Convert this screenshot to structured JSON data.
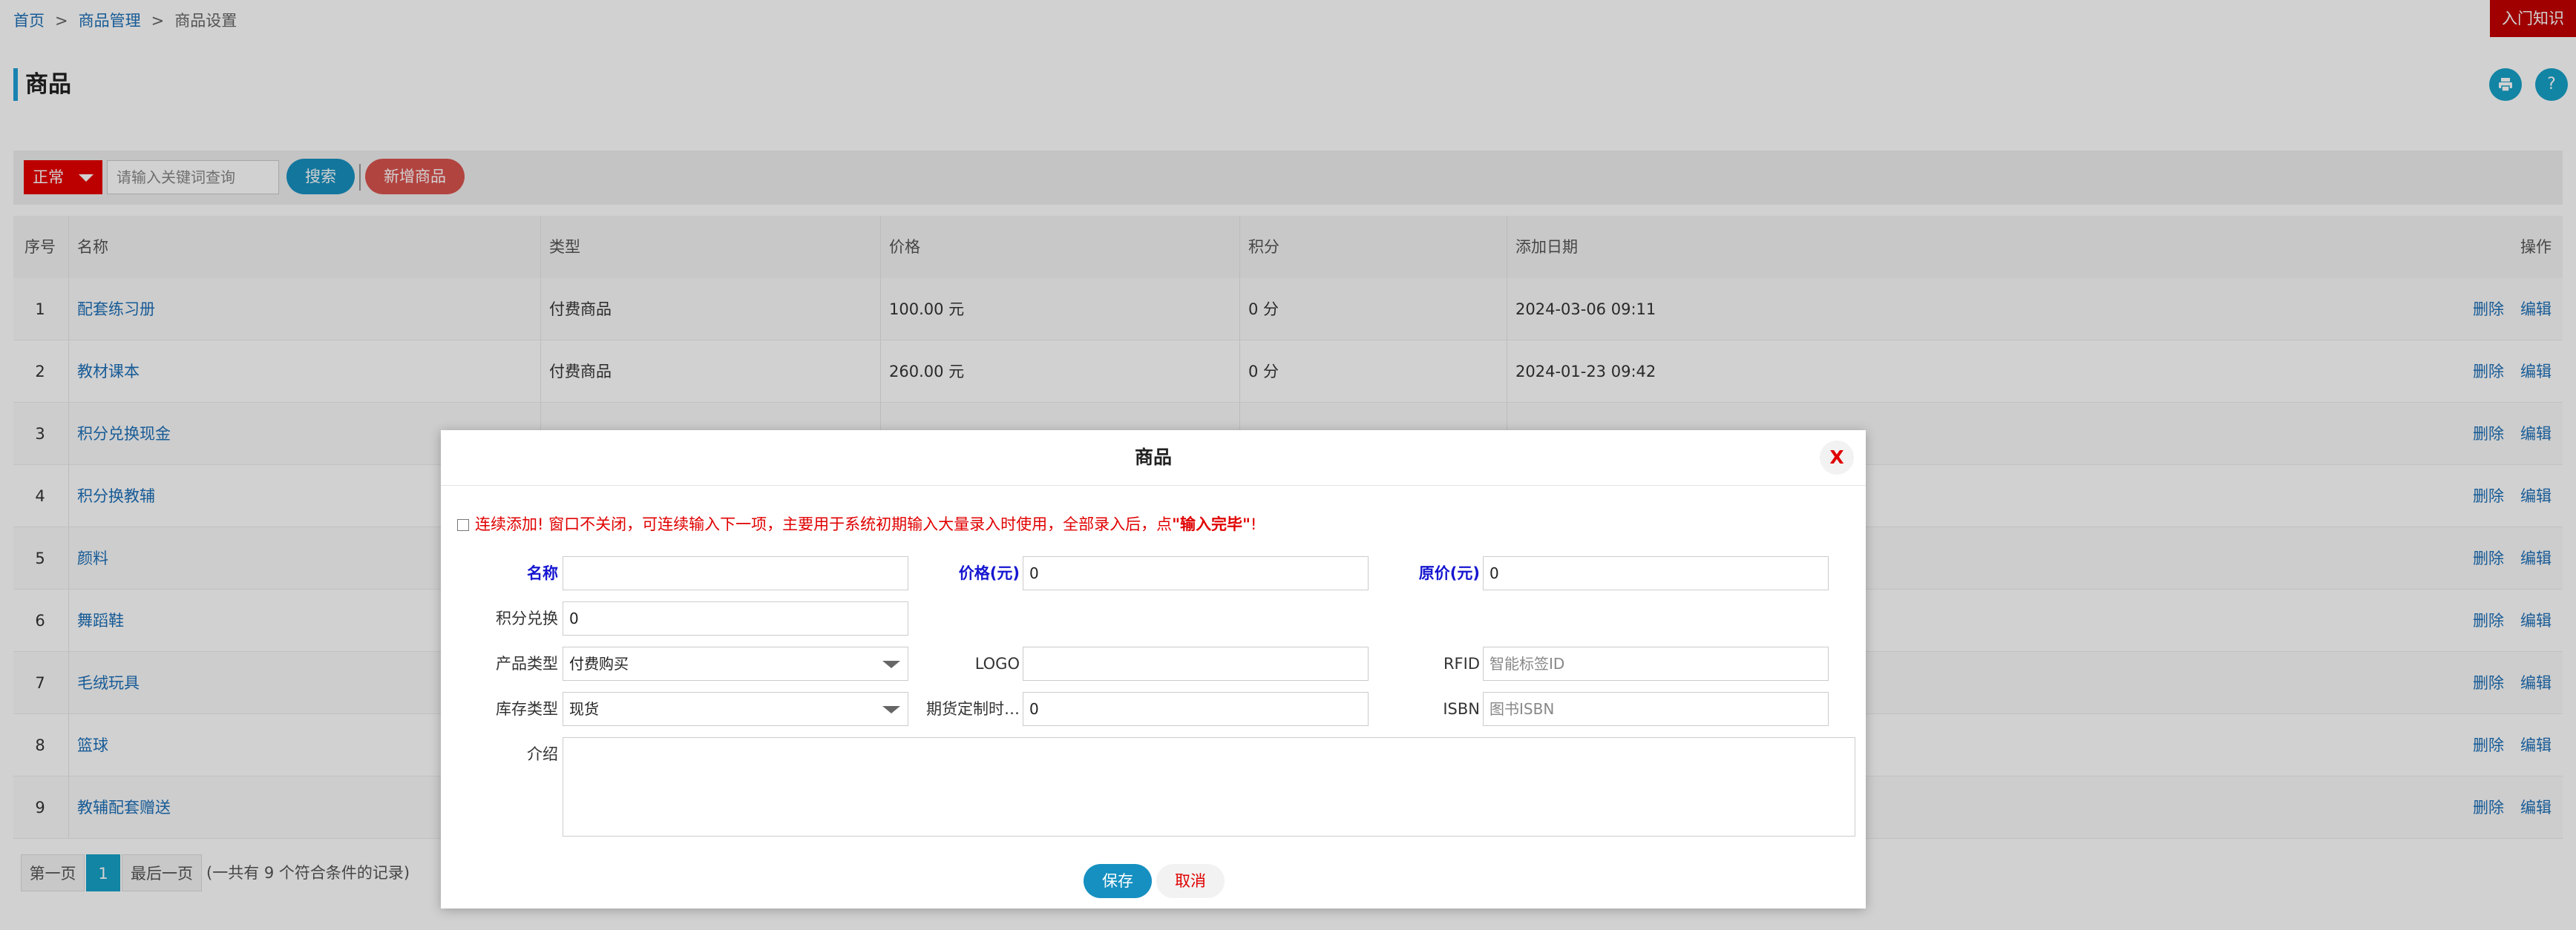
{
  "breadcrumb": {
    "home": "首页",
    "sep1": ">",
    "products": "商品管理",
    "sep2": ">",
    "current": "商品设置"
  },
  "header": {
    "intro_button": "入门知识",
    "page_title": "商品",
    "help_icon_text": "?"
  },
  "toolbar": {
    "status_value": "正常",
    "search_placeholder": "请输入关键词查询",
    "search_button": "搜索",
    "add_button": "新增商品"
  },
  "table": {
    "columns": [
      "序号",
      "名称",
      "类型",
      "价格",
      "积分",
      "添加日期",
      "操作"
    ],
    "delete_label": "删除",
    "edit_label": "编辑",
    "rows": [
      {
        "idx": "1",
        "name": "配套练习册",
        "type": "付费商品",
        "price": "100.00 元",
        "points": "0 分",
        "date": "2024-03-06 09:11"
      },
      {
        "idx": "2",
        "name": "教材课本",
        "type": "付费商品",
        "price": "260.00 元",
        "points": "0 分",
        "date": "2024-01-23 09:42"
      },
      {
        "idx": "3",
        "name": "积分兑换现金",
        "type": "",
        "price": "",
        "points": "",
        "date": ""
      },
      {
        "idx": "4",
        "name": "积分换教辅",
        "type": "",
        "price": "",
        "points": "",
        "date": ""
      },
      {
        "idx": "5",
        "name": "颜料",
        "type": "",
        "price": "",
        "points": "",
        "date": ""
      },
      {
        "idx": "6",
        "name": "舞蹈鞋",
        "type": "",
        "price": "",
        "points": "",
        "date": ""
      },
      {
        "idx": "7",
        "name": "毛绒玩具",
        "type": "",
        "price": "",
        "points": "",
        "date": ""
      },
      {
        "idx": "8",
        "name": "篮球",
        "type": "",
        "price": "",
        "points": "",
        "date": ""
      },
      {
        "idx": "9",
        "name": "教辅配套赠送",
        "type": "",
        "price": "",
        "points": "",
        "date": ""
      }
    ]
  },
  "pagination": {
    "first": "第一页",
    "current": "1",
    "last": "最后一页",
    "summary": "(一共有 9 个符合条件的记录)"
  },
  "modal": {
    "title": "商品",
    "close": "X",
    "notice_prefix": "连续添加!  窗口不关闭，可连续输入下一项，主要用于系统初期输入大量录入时使用，全部录入后，点",
    "notice_emph": "\"输入完毕\"",
    "notice_suffix": "!",
    "form": {
      "name_label": "名称",
      "name_value": "",
      "price_label": "价格(元)",
      "price_value": "0",
      "orig_price_label": "原价(元)",
      "orig_price_value": "0",
      "points_label": "积分兑换",
      "points_value": "0",
      "product_type_label": "产品类型",
      "product_type_value": "付费购买",
      "logo_label": "LOGO",
      "logo_value": "",
      "rfid_label": "RFID",
      "rfid_placeholder": "智能标签ID",
      "stock_type_label": "库存类型",
      "stock_type_value": "现货",
      "preorder_label": "期货定制时…",
      "preorder_value": "0",
      "isbn_label": "ISBN",
      "isbn_placeholder": "图书ISBN",
      "intro_label": "介绍"
    },
    "save_button": "保存",
    "cancel_button": "取消"
  },
  "colors": {
    "accent": "#17a2c8",
    "danger": "#e00000",
    "link": "#1d6fb8",
    "required_label": "#1515d0"
  }
}
